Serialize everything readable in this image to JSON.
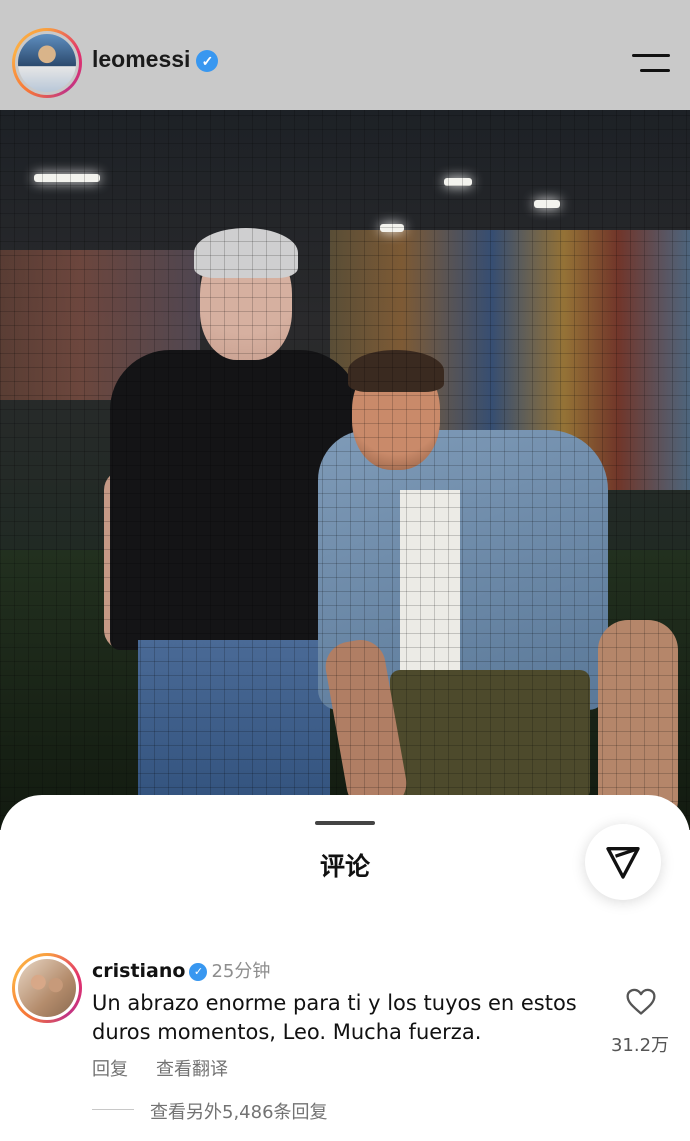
{
  "header": {
    "username": "leomessi",
    "verified_mark": "✓",
    "avatar": "profile-avatar",
    "menu_icon": "hamburger-menu-icon"
  },
  "post": {
    "image": "photo of two men standing in an indoor football facility"
  },
  "comments_sheet": {
    "title": "评论",
    "share_icon": "send-icon",
    "comment": {
      "username": "cristiano",
      "verified_mark": "✓",
      "time": "25分钟",
      "text": "Un abrazo enorme para ti y los tuyos en estos duros momentos, Leo. Mucha fuerza.",
      "reply_label": "回复",
      "translate_label": "查看翻译",
      "like_count": "31.2万",
      "view_replies_label": "查看另外5,486条回复"
    }
  },
  "colors": {
    "header_bg": "#c9c9c9",
    "verified_blue": "#3897f0",
    "muted_text": "#737373"
  }
}
